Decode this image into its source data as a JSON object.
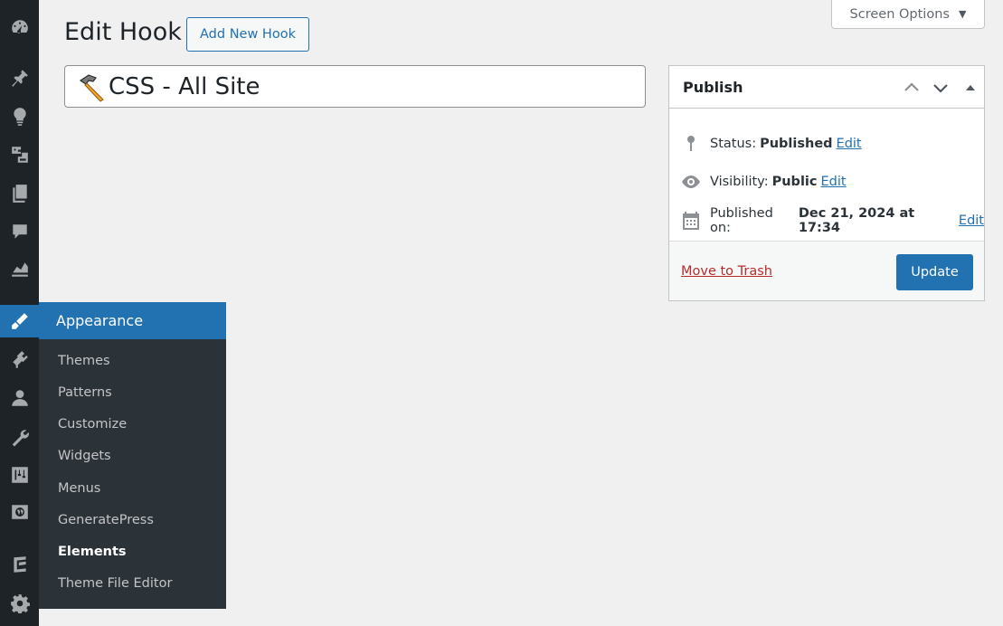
{
  "header": {
    "title": "Edit Hook",
    "add_new_label": "Add New Hook",
    "screen_options_label": "Screen Options"
  },
  "title_field": {
    "value": "CSS - All Site"
  },
  "sidebar": {
    "icons": [
      "dashboard-icon",
      "pin-icon",
      "lightbulb-icon",
      "media-icon",
      "pages-icon",
      "comments-icon",
      "chart-icon",
      "appearance-icon",
      "plugins-icon",
      "users-icon",
      "tools-icon",
      "settings-sliders-icon",
      "wordpress-icon",
      "generatepress-icon",
      "gear-icon"
    ],
    "flyout": {
      "heading": "Appearance",
      "items": [
        {
          "label": "Themes"
        },
        {
          "label": "Patterns"
        },
        {
          "label": "Customize"
        },
        {
          "label": "Widgets"
        },
        {
          "label": "Menus"
        },
        {
          "label": "GeneratePress"
        },
        {
          "label": "Elements"
        },
        {
          "label": "Theme File Editor"
        }
      ],
      "current": "Elements"
    }
  },
  "publish": {
    "title": "Publish",
    "status_label": "Status:",
    "status_value": "Published",
    "visibility_label": "Visibility:",
    "visibility_value": "Public",
    "published_label": "Published on:",
    "published_value": "Dec 21, 2024 at 17:34",
    "edit_label": "Edit",
    "trash_label": "Move to Trash",
    "update_label": "Update"
  },
  "colors": {
    "accent": "#2271b1",
    "sidebar_bg": "#1d2327",
    "flyout_bg": "#2c3338",
    "trash": "#b32d2e"
  }
}
